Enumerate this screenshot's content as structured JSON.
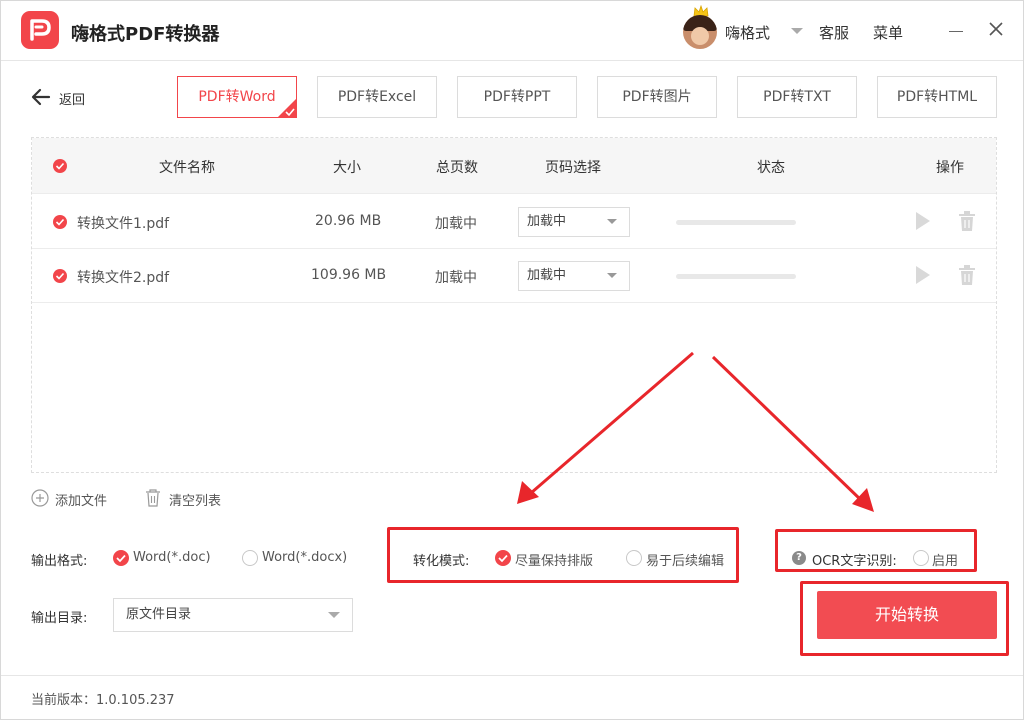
{
  "app": {
    "title": "嗨格式PDF转换器",
    "user_name": "嗨格式",
    "service_label": "客服",
    "menu_label": "菜单"
  },
  "nav": {
    "back_label": "返回",
    "tabs": [
      {
        "label": "PDF转Word",
        "active": true
      },
      {
        "label": "PDF转Excel",
        "active": false
      },
      {
        "label": "PDF转PPT",
        "active": false
      },
      {
        "label": "PDF转图片",
        "active": false
      },
      {
        "label": "PDF转TXT",
        "active": false
      },
      {
        "label": "PDF转HTML",
        "active": false
      }
    ]
  },
  "table": {
    "headers": {
      "name": "文件名称",
      "size": "大小",
      "pages": "总页数",
      "page_select": "页码选择",
      "status": "状态",
      "actions": "操作"
    },
    "rows": [
      {
        "name": "转换文件1.pdf",
        "size": "20.96 MB",
        "pages": "加载中",
        "page_select": "加载中"
      },
      {
        "name": "转换文件2.pdf",
        "size": "109.96 MB",
        "pages": "加载中",
        "page_select": "加载中"
      }
    ]
  },
  "list_actions": {
    "add_file": "添加文件",
    "clear_list": "清空列表"
  },
  "output": {
    "format_label": "输出格式:",
    "format_options": [
      {
        "label": "Word(*.doc)",
        "selected": true
      },
      {
        "label": "Word(*.docx)",
        "selected": false
      }
    ],
    "mode_label": "转化模式:",
    "mode_options": [
      {
        "label": "尽量保持排版",
        "selected": true
      },
      {
        "label": "易于后续编辑",
        "selected": false
      }
    ],
    "ocr_label": "OCR文字识别:",
    "ocr_option": "启用",
    "ocr_enabled": false,
    "dir_label": "输出目录:",
    "dir_value": "原文件目录"
  },
  "start_button": "开始转换",
  "footer": {
    "version": "当前版本：1.0.105.237"
  },
  "colors": {
    "accent": "#f2454a",
    "annotation": "#e8262b"
  }
}
